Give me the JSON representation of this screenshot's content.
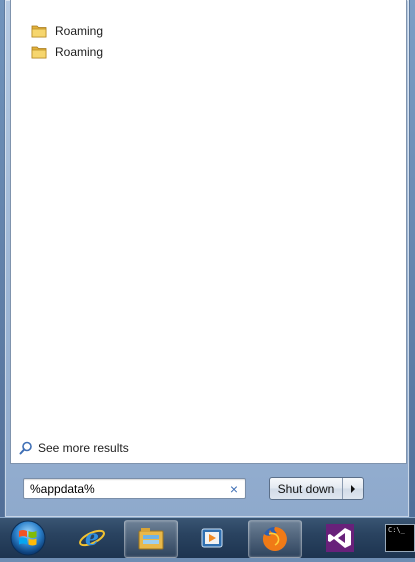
{
  "results": {
    "items": [
      {
        "label": "Roaming",
        "icon": "folder-icon"
      },
      {
        "label": "Roaming",
        "icon": "folder-icon"
      }
    ],
    "see_more_label": "See more results"
  },
  "search": {
    "value": "%appdata%",
    "clear_glyph": "×"
  },
  "shutdown": {
    "label": "Shut down"
  },
  "taskbar": {
    "items": [
      {
        "name": "start-orb",
        "icon": "windows-logo-icon"
      },
      {
        "name": "internet-explorer",
        "icon": "internet-explorer-icon"
      },
      {
        "name": "windows-explorer",
        "icon": "folder-library-icon"
      },
      {
        "name": "media-player",
        "icon": "media-player-icon"
      },
      {
        "name": "firefox",
        "icon": "firefox-icon"
      },
      {
        "name": "visual-studio",
        "icon": "visual-studio-icon"
      },
      {
        "name": "command-prompt",
        "icon": "command-prompt-icon"
      }
    ],
    "cmd_text": "C:\\_"
  },
  "colors": {
    "menu_glass": "#9eb7d6",
    "taskbar": "#2a4360",
    "visual_studio": "#68217a",
    "accent_blue": "#3f6fb5"
  }
}
